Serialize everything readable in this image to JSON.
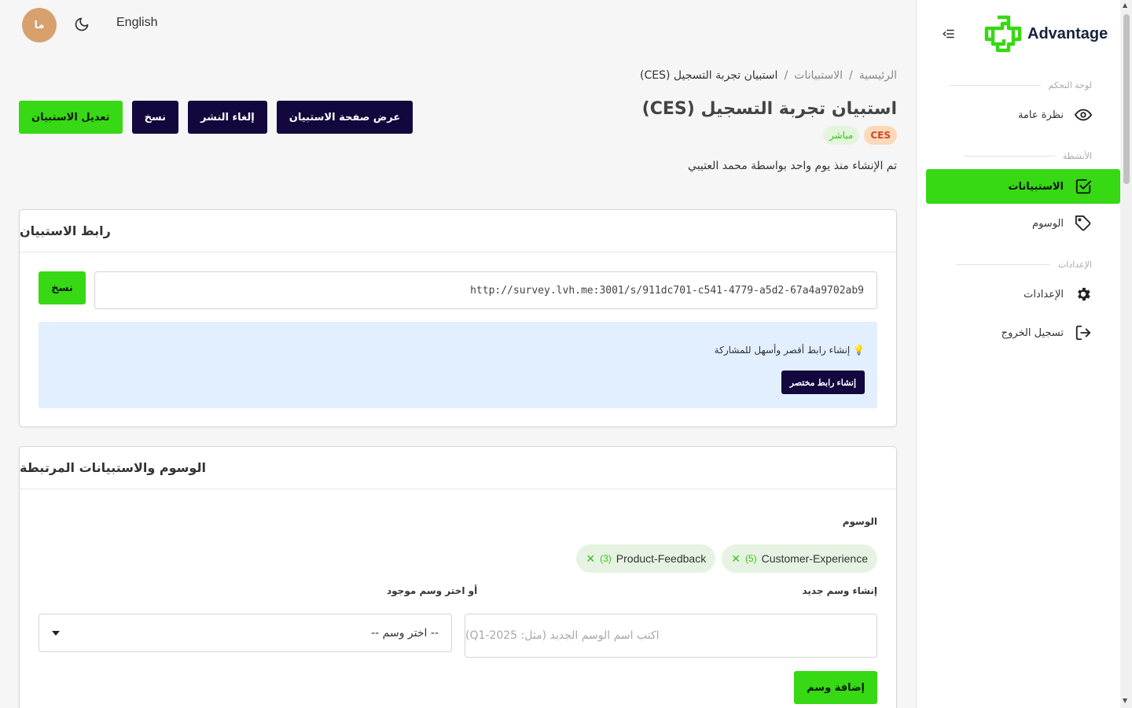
{
  "topbar": {
    "avatar_initials": "ما",
    "language": "English"
  },
  "sidebar": {
    "brand": "Advantage",
    "sections": {
      "dashboard": "لوحة التحكم",
      "activities": "الأنشطة",
      "settings": "الإعدادات"
    },
    "items": {
      "overview": "نظرة عامة",
      "surveys": "الاستبيانات",
      "tags": "الوسوم",
      "settings": "الإعدادات",
      "logout": "تسجيل الخروج"
    }
  },
  "breadcrumb": {
    "home": "الرئيسية",
    "separator": "/",
    "surveys": "الاستبيانات",
    "current": "استبيان تجربة التسجيل (CES)"
  },
  "page": {
    "title": "استبيان تجربة التسجيل (CES)",
    "badge_type": "CES",
    "badge_status": "مباشر",
    "created": "تم الإنشاء منذ يوم واحد بواسطة محمد العتيبي"
  },
  "actions": {
    "edit": "تعديل الاستبيان",
    "copy": "نسخ",
    "unpublish": "إلغاء النشر",
    "view_page": "عرض صفحة الاستبيان"
  },
  "link_card": {
    "title": "رابط الاستبيان",
    "url": "http://survey.lvh.me:3001/s/911dc701-c541-4779-a5d2-67a4a9702ab9",
    "copy": "نسخ",
    "tip": "💡 إنشاء رابط أقصر وأسهل للمشاركة",
    "short_link_button": "إنشاء رابط مختصر"
  },
  "tags_card": {
    "title": "الوسوم والاستبيانات المرتبطة",
    "tags_label": "الوسوم",
    "tags": [
      {
        "name": "Customer-Experience",
        "count": "(5)"
      },
      {
        "name": "Product-Feedback",
        "count": "(3)"
      }
    ],
    "new_tag_label": "إنشاء وسم جديد",
    "new_tag_placeholder": "اكتب اسم الوسم الجديد (مثل: Q1-2025)",
    "pick_label": "أو اختر وسم موجود",
    "pick_value": "-- اختر وسم --",
    "add_button": "إضافة وسم"
  },
  "colors": {
    "accent": "#37d814",
    "dark": "#12083e",
    "tip_bg": "#e1efff"
  }
}
